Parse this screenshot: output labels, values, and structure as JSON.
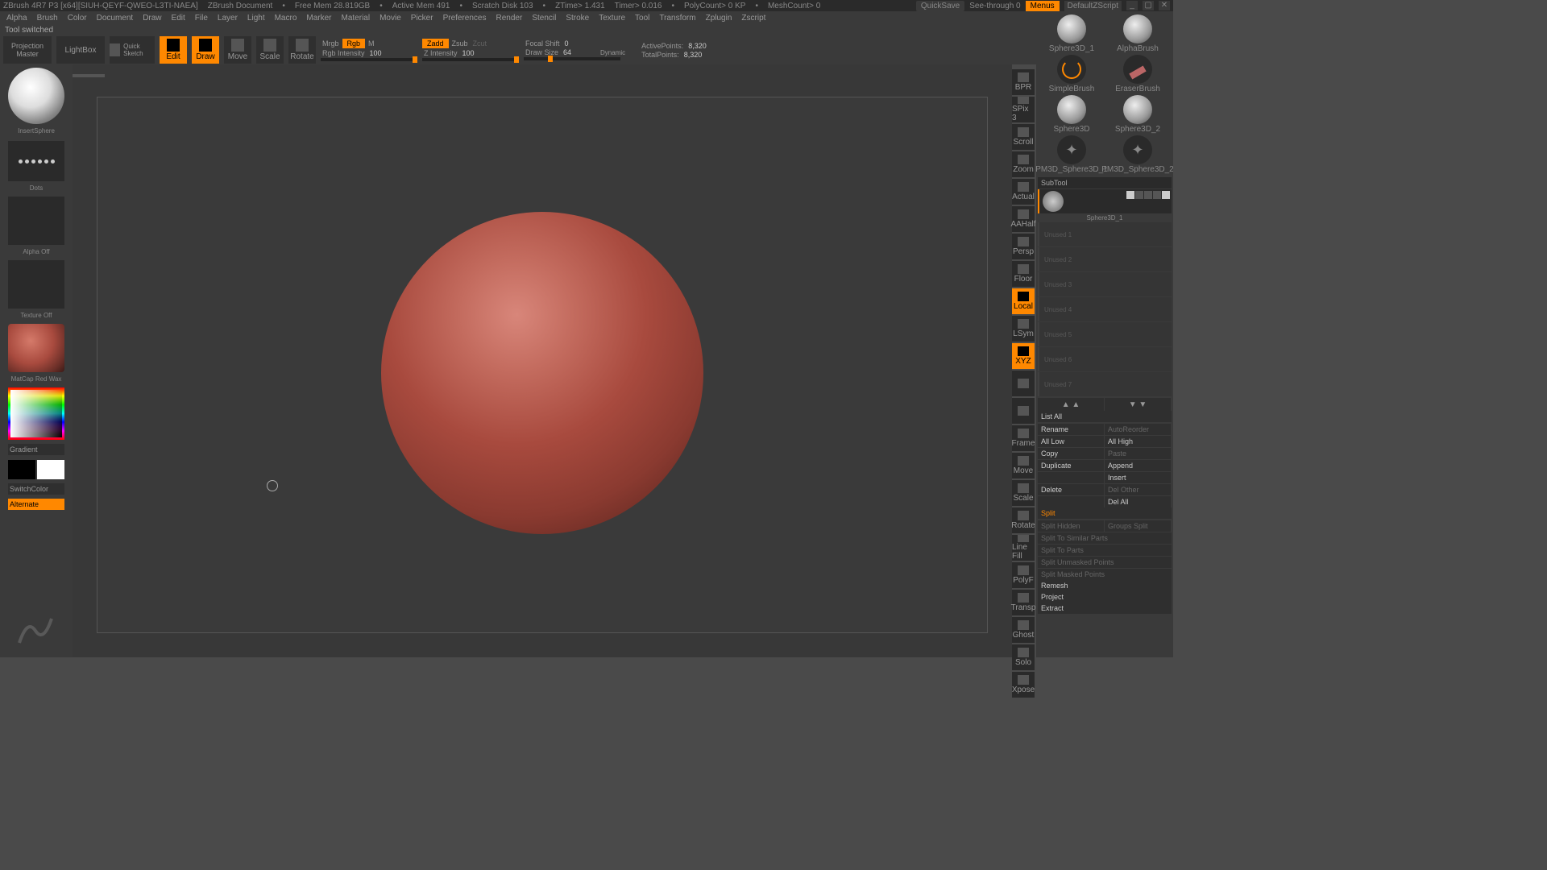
{
  "titlebar": {
    "app": "ZBrush 4R7 P3  [x64][SIUH-QEYF-QWEO-L3TI-NAEA]",
    "doc": "ZBrush Document",
    "freemem": "Free Mem 28.819GB",
    "activemem": "Active Mem 491",
    "scratch": "Scratch Disk 103",
    "ztime": "ZTime> 1.431",
    "timer": "Timer> 0.016",
    "poly": "PolyCount> 0 KP",
    "mesh": "MeshCount> 0",
    "quicksave": "QuickSave",
    "seethrough": "See-through   0",
    "menus": "Menus",
    "defaultz": "DefaultZScript"
  },
  "menu": [
    "Alpha",
    "Brush",
    "Color",
    "Document",
    "Draw",
    "Edit",
    "File",
    "Layer",
    "Light",
    "Macro",
    "Marker",
    "Material",
    "Movie",
    "Picker",
    "Preferences",
    "Render",
    "Stencil",
    "Stroke",
    "Texture",
    "Tool",
    "Transform",
    "Zplugin",
    "Zscript"
  ],
  "status": "Tool switched",
  "toolbar": {
    "projection": "Projection Master",
    "lightbox": "LightBox",
    "quicksketch": "Quick Sketch",
    "edit": "Edit",
    "draw": "Draw",
    "move": "Move",
    "scale": "Scale",
    "rotate": "Rotate",
    "mrgb": "Mrgb",
    "rgb": "Rgb",
    "m": "M",
    "rgbint_label": "Rgb Intensity",
    "rgbint_val": "100",
    "zadd": "Zadd",
    "zsub": "Zsub",
    "zcut": "Zcut",
    "zint_label": "Z Intensity",
    "zint_val": "100",
    "focal_label": "Focal Shift",
    "focal_val": "0",
    "drawsize_label": "Draw Size",
    "drawsize_val": "64",
    "dynamic": "Dynamic",
    "active_label": "ActivePoints:",
    "active_val": "8,320",
    "total_label": "TotalPoints:",
    "total_val": "8,320"
  },
  "left": {
    "brush": "InsertSphere",
    "stroke": "Dots",
    "alpha": "Alpha Off",
    "texture": "Texture Off",
    "material": "MatCap Red Wax",
    "gradient": "Gradient",
    "switch": "SwitchColor",
    "alternate": "Alternate"
  },
  "rightstrip": [
    "BPR",
    "SPix 3",
    "Scroll",
    "Zoom",
    "Actual",
    "AAHalf",
    "Persp",
    "Floor",
    "Local",
    "LSym",
    "XYZ",
    "",
    "",
    "Frame",
    "Move",
    "Scale",
    "Rotate",
    "Line Fill",
    "PolyF",
    "Transp",
    "Ghost",
    "Solo",
    "Xpose"
  ],
  "brushes": [
    "Sphere3D_1",
    "AlphaBrush",
    "SimpleBrush",
    "EraserBrush",
    "Sphere3D",
    "Sphere3D_2",
    "PM3D_Sphere3D_1",
    "PM3D_Sphere3D_2"
  ],
  "subtool": {
    "header": "SubTool",
    "name": "Sphere3D_1",
    "placeholders": [
      "Unused 1",
      "Unused 2",
      "Unused 3",
      "Unused 4",
      "Unused 5",
      "Unused 6",
      "Unused 7"
    ],
    "listall": "List All",
    "rename": "Rename",
    "autoreorder": "AutoReorder",
    "alllow": "All Low",
    "allhigh": "All High",
    "copy": "Copy",
    "paste": "Paste",
    "duplicate": "Duplicate",
    "append": "Append",
    "insert": "Insert",
    "delete": "Delete",
    "delother": "Del Other",
    "delall": "Del All",
    "split": "Split",
    "splithidden": "Split Hidden",
    "groupssplit": "Groups Split",
    "splitsimilar": "Split To Similar Parts",
    "splitparts": "Split To Parts",
    "splitunmasked": "Split Unmasked Points",
    "splitmasked": "Split Masked Points",
    "remesh": "Remesh",
    "project": "Project",
    "extract": "Extract"
  }
}
